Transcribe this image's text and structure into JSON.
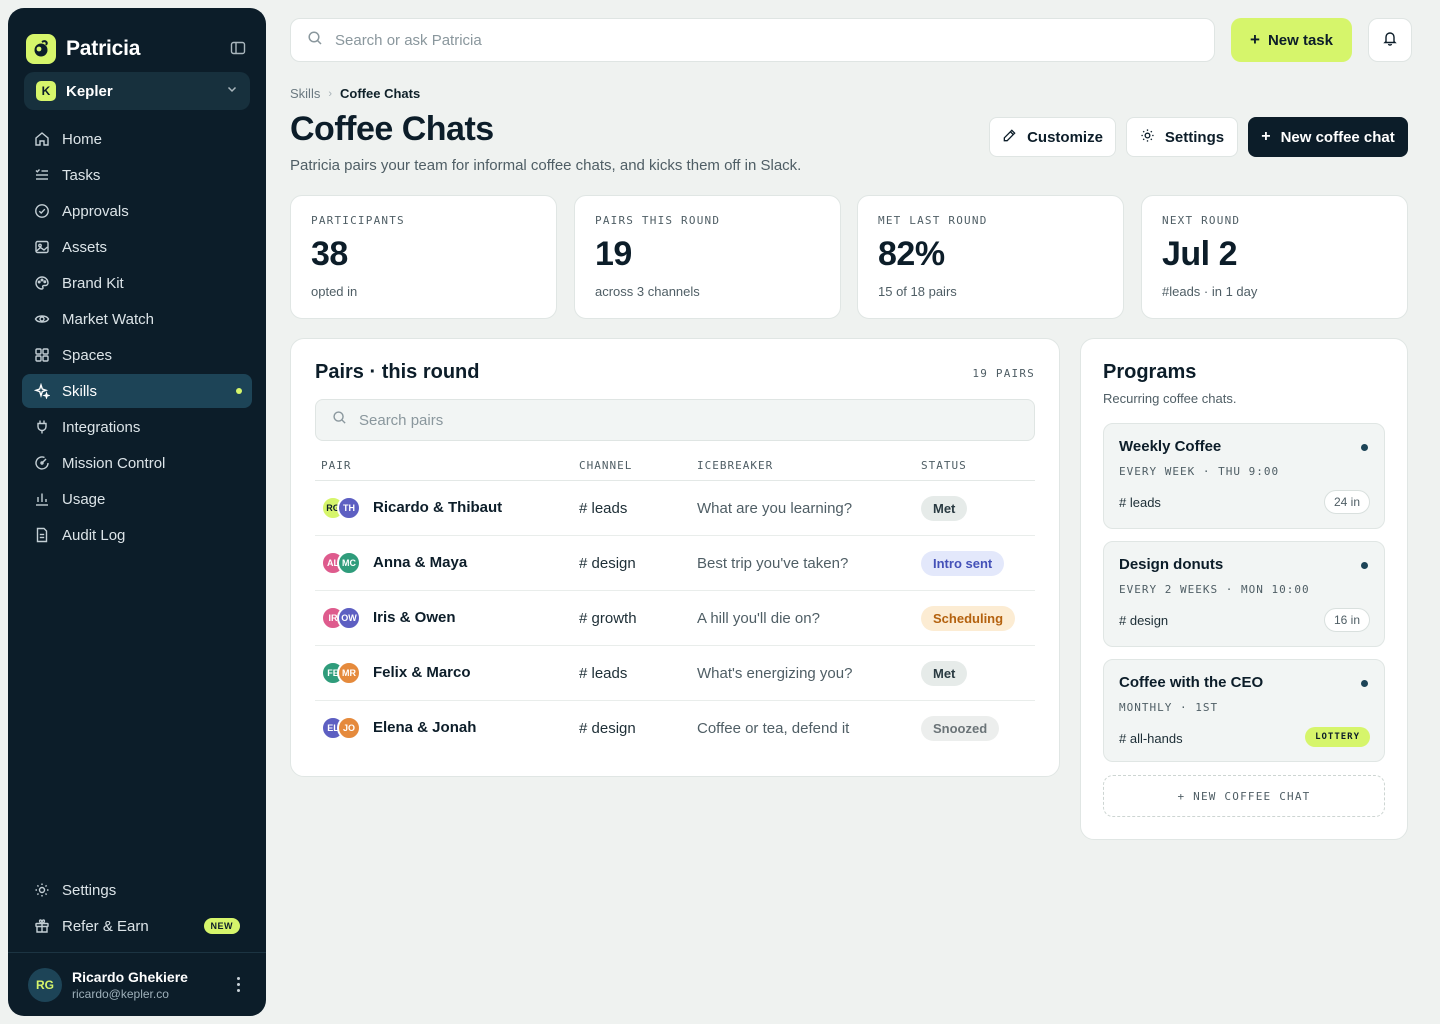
{
  "app": {
    "name": "Patricia",
    "logo_icon": "patricia-logo"
  },
  "workspace": {
    "initial": "K",
    "name": "Kepler"
  },
  "nav": [
    {
      "label": "Home",
      "icon": "home-icon"
    },
    {
      "label": "Tasks",
      "icon": "tasks-icon"
    },
    {
      "label": "Approvals",
      "icon": "check-circle-icon"
    },
    {
      "label": "Assets",
      "icon": "image-icon"
    },
    {
      "label": "Brand Kit",
      "icon": "palette-icon"
    },
    {
      "label": "Market Watch",
      "icon": "eye-icon"
    },
    {
      "label": "Spaces",
      "icon": "grid-icon"
    },
    {
      "label": "Skills",
      "icon": "sparkle-icon",
      "active": true
    },
    {
      "label": "Integrations",
      "icon": "plug-icon"
    },
    {
      "label": "Mission Control",
      "icon": "gauge-icon"
    },
    {
      "label": "Usage",
      "icon": "bar-chart-icon"
    },
    {
      "label": "Audit Log",
      "icon": "document-icon"
    }
  ],
  "nav_bottom": {
    "settings": "Settings",
    "refer": "Refer & Earn",
    "refer_badge": "NEW"
  },
  "user": {
    "initials": "RG",
    "name": "Ricardo Ghekiere",
    "email": "ricardo@kepler.co"
  },
  "topbar": {
    "search_placeholder": "Search or ask Patricia",
    "new_task": "New task"
  },
  "breadcrumb": {
    "parent": "Skills",
    "current": "Coffee Chats"
  },
  "page": {
    "title": "Coffee Chats",
    "subtitle": "Patricia pairs your team for informal coffee chats, and kicks them off in Slack.",
    "customize": "Customize",
    "settings": "Settings",
    "new_chat": "New coffee chat"
  },
  "stats": [
    {
      "label": "PARTICIPANTS",
      "value": "38",
      "note": "opted in"
    },
    {
      "label": "PAIRS THIS ROUND",
      "value": "19",
      "note": "across 3 channels"
    },
    {
      "label": "MET LAST ROUND",
      "value": "82%",
      "note": "15 of 18 pairs"
    },
    {
      "label": "NEXT ROUND",
      "value": "Jul 2",
      "note": "#leads · in 1 day"
    }
  ],
  "pairs": {
    "title": "Pairs · this round",
    "count": "19 PAIRS",
    "search_placeholder": "Search pairs",
    "columns": [
      "PAIR",
      "CHANNEL",
      "ICEBREAKER",
      "STATUS"
    ],
    "rows": [
      {
        "a1": "RG",
        "a1_color": "#d6f56b",
        "a1_text": "#0c1d29",
        "a2": "TH",
        "a2_color": "#5d5fc2",
        "name": "Ricardo & Thibaut",
        "channel": "# leads",
        "icebreaker": "What are you learning?",
        "status": "Met",
        "status_bg": "#e6ebe9",
        "status_fg": "#2a3b42"
      },
      {
        "a1": "AL",
        "a1_color": "#de5b8d",
        "a1_text": "#ffffff",
        "a2": "MC",
        "a2_color": "#2f9c7b",
        "name": "Anna & Maya",
        "channel": "# design",
        "icebreaker": "Best trip you've taken?",
        "status": "Intro sent",
        "status_bg": "#e3e8fb",
        "status_fg": "#4451b8"
      },
      {
        "a1": "IR",
        "a1_color": "#de5b8d",
        "a1_text": "#ffffff",
        "a2": "OW",
        "a2_color": "#5d5fc2",
        "name": "Iris & Owen",
        "channel": "# growth",
        "icebreaker": "A hill you'll die on?",
        "status": "Scheduling",
        "status_bg": "#fcecd3",
        "status_fg": "#b4620f"
      },
      {
        "a1": "FE",
        "a1_color": "#2f9c7b",
        "a1_text": "#ffffff",
        "a2": "MR",
        "a2_color": "#e58a3c",
        "name": "Felix & Marco",
        "channel": "# leads",
        "icebreaker": "What's energizing you?",
        "status": "Met",
        "status_bg": "#e6ebe9",
        "status_fg": "#2a3b42"
      },
      {
        "a1": "EL",
        "a1_color": "#5d5fc2",
        "a1_text": "#ffffff",
        "a2": "JO",
        "a2_color": "#e58a3c",
        "name": "Elena & Jonah",
        "channel": "# design",
        "icebreaker": "Coffee or tea, defend it",
        "status": "Snoozed",
        "status_bg": "#eceeed",
        "status_fg": "#6b7478"
      }
    ]
  },
  "programs": {
    "title": "Programs",
    "subtitle": "Recurring coffee chats.",
    "items": [
      {
        "name": "Weekly Coffee",
        "schedule": "EVERY WEEK · THU 9:00",
        "channel": "# leads",
        "tag": "24 in",
        "tag_type": "count"
      },
      {
        "name": "Design donuts",
        "schedule": "EVERY 2 WEEKS · MON 10:00",
        "channel": "# design",
        "tag": "16 in",
        "tag_type": "count"
      },
      {
        "name": "Coffee with the CEO",
        "schedule": "MONTHLY · 1ST",
        "channel": "# all-hands",
        "tag": "LOTTERY",
        "tag_type": "lottery"
      }
    ],
    "new_label": "+ NEW COFFEE CHAT"
  },
  "colors": {
    "sidebar": "#0c1d29",
    "accent": "#d6f56b",
    "active_nav": "#1d4457",
    "page_bg": "#eff2f0"
  }
}
